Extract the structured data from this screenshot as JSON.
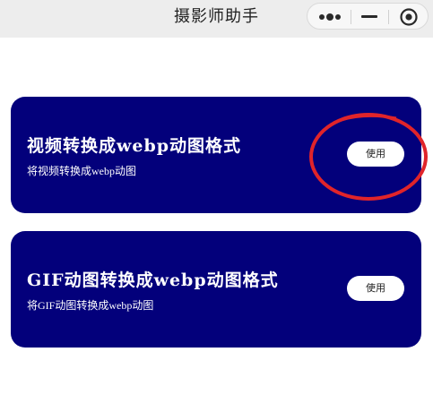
{
  "nav": {
    "title": "摄影师助手",
    "more_icon": "more-dots-icon",
    "minimize_icon": "minimize-icon",
    "close_icon": "target-close-icon"
  },
  "cards": [
    {
      "title": "视频转换成webp动图格式",
      "subtitle": "将视频转换成webp动图",
      "button_label": "使用"
    },
    {
      "title": "GIF动图转换成webp动图格式",
      "subtitle": "将GIF动图转换成webp动图",
      "button_label": "使用"
    }
  ],
  "colors": {
    "card_background": "#03007b",
    "nav_background": "#ededed",
    "annotation": "#e0242a"
  }
}
